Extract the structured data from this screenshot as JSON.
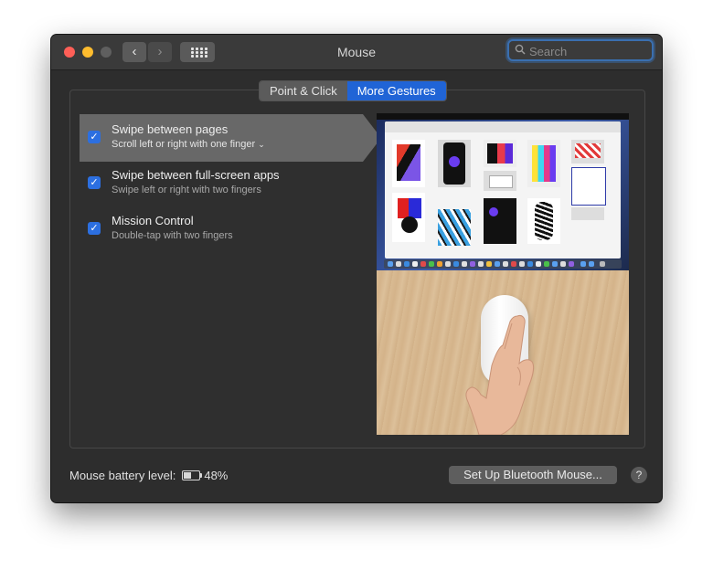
{
  "window": {
    "title": "Mouse"
  },
  "toolbar": {
    "back_icon": "chevron-left-icon",
    "forward_icon": "chevron-right-icon",
    "show_all_icon": "grid-icon"
  },
  "search": {
    "placeholder": "Search",
    "value": ""
  },
  "tabs": [
    {
      "label": "Point & Click",
      "active": false
    },
    {
      "label": "More Gestures",
      "active": true
    }
  ],
  "gestures": [
    {
      "title": "Swipe between pages",
      "subtitle": "Scroll left or right with one finger",
      "checked": true,
      "selected": true,
      "has_dropdown": true
    },
    {
      "title": "Swipe between full-screen apps",
      "subtitle": "Swipe left or right with two fingers",
      "checked": true,
      "selected": false
    },
    {
      "title": "Mission Control",
      "subtitle": "Double-tap with two fingers",
      "checked": true,
      "selected": false
    }
  ],
  "battery": {
    "label": "Mouse battery level:",
    "percent_text": "48%",
    "level": 0.48
  },
  "buttons": {
    "setup_bluetooth": "Set Up Bluetooth Mouse...",
    "help": "?"
  },
  "colors": {
    "accent": "#2064d6",
    "window_bg": "#2d2d2d",
    "selected_row": "#686868"
  }
}
